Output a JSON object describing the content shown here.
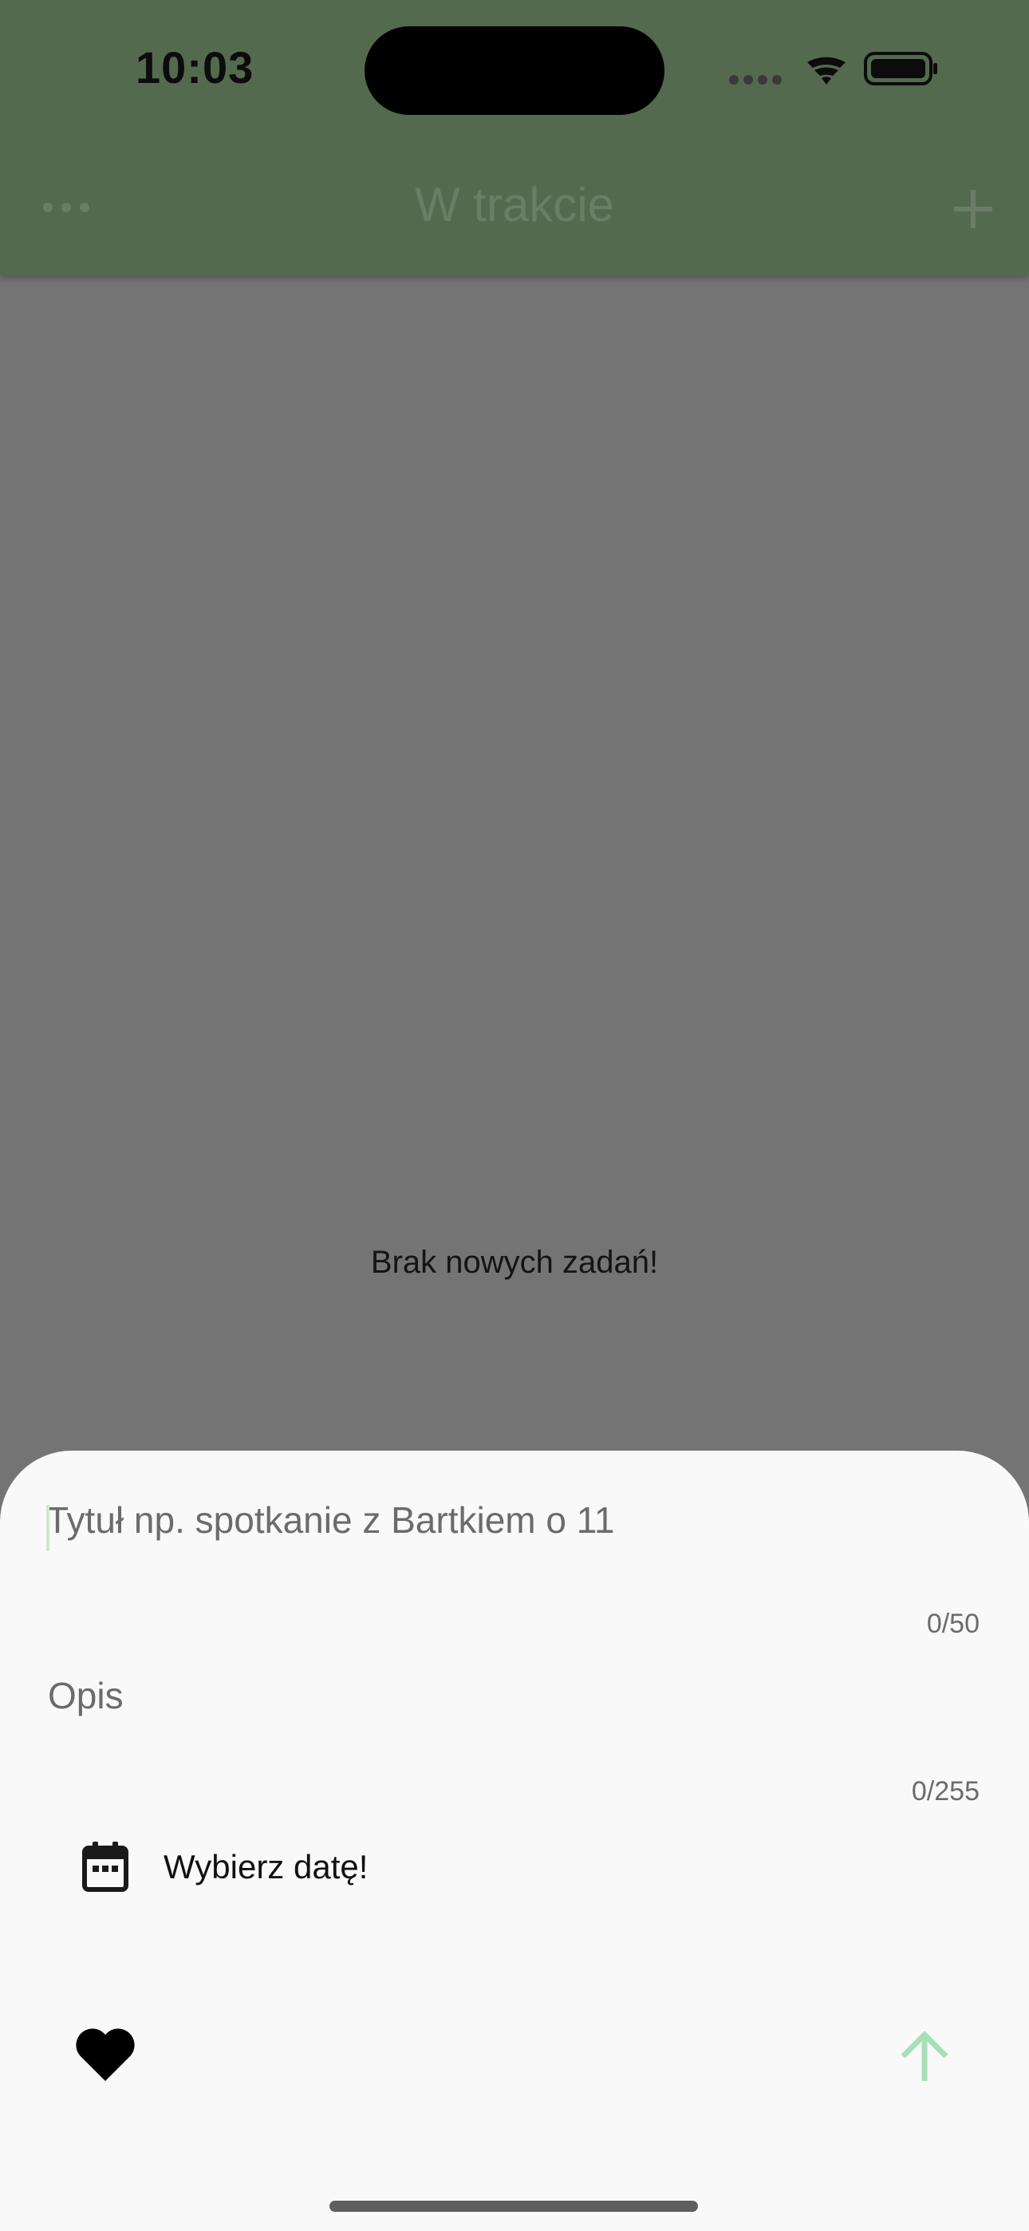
{
  "status_bar": {
    "time": "10:03"
  },
  "nav_bar": {
    "title": "W trakcie",
    "more_icon": "ellipsis-icon",
    "add_icon": "plus-icon"
  },
  "main": {
    "empty_message": "Brak nowych zadań!"
  },
  "sheet": {
    "title_field": {
      "value": "",
      "placeholder": "Tytuł np. spotkanie z Bartkiem o 11",
      "counter": "0/50"
    },
    "description_field": {
      "value": "",
      "placeholder": "Opis",
      "counter": "0/255"
    },
    "date_picker": {
      "label": "Wybierz datę!",
      "icon": "calendar-icon"
    },
    "favorite_icon": "heart-icon",
    "send_icon": "arrow-up-icon"
  },
  "colors": {
    "app_bar": "#546a4e",
    "overlay": "#747474",
    "sheet_bg": "#f9f9f9",
    "accent_light_green": "#a8e0b6"
  }
}
